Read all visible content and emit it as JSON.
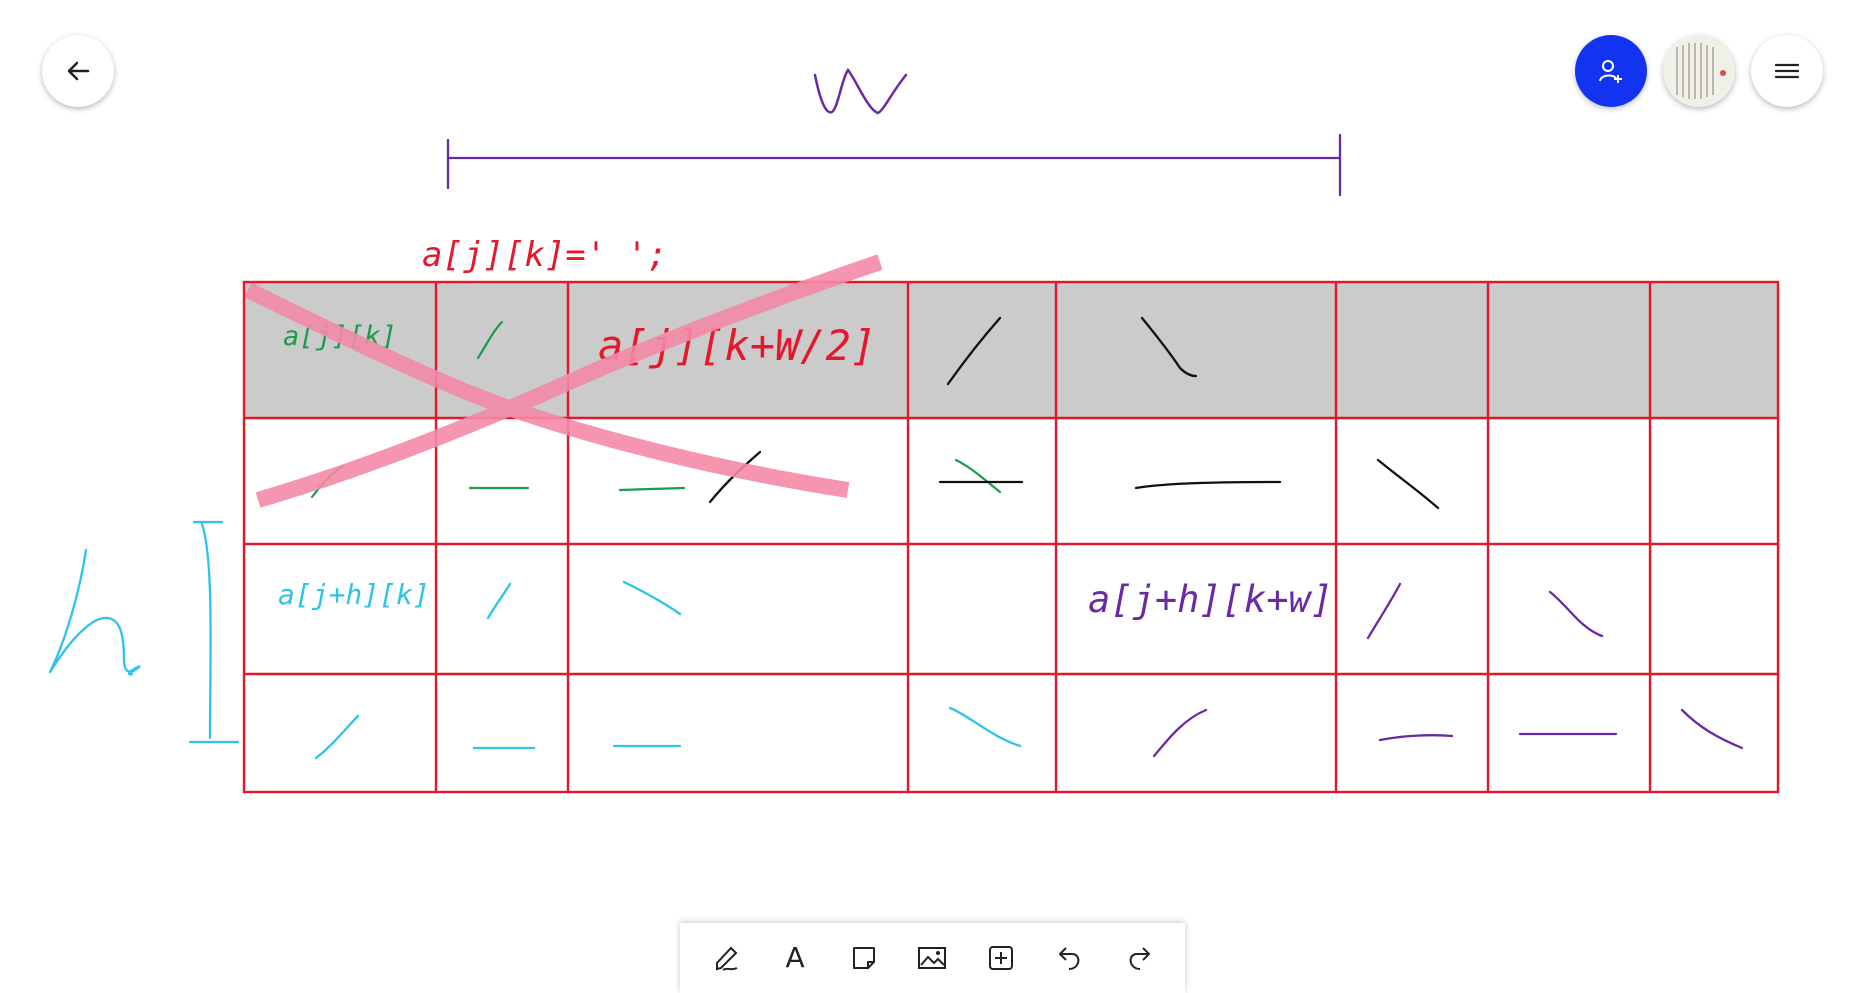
{
  "header": {
    "back": {
      "icon": "arrow-left-icon"
    },
    "invite": {
      "icon": "person-add-icon",
      "color": "#1234f0"
    },
    "avatar": {
      "icon": "avatar-image"
    },
    "menu": {
      "icon": "hamburger-menu-icon"
    }
  },
  "board": {
    "width_label": "W",
    "height_label": "h",
    "red_note": "a[j][k]=' ';",
    "cell_text": {
      "r0c0": "a[j][k]",
      "r0c2": "a[j][k+W/2]",
      "r2c0": "a[j+h][k]",
      "r2c4": "a[j+h][k+w]"
    },
    "colors": {
      "grid": "#e5182b",
      "header_fill": "#cbcbcb",
      "highlight_x": "#f48aa8",
      "green": "#1a9d4a",
      "red": "#e5182b",
      "cyan": "#2ec4ea",
      "purple": "#6a2aa6",
      "black": "#111111"
    }
  },
  "toolbar": {
    "tools": [
      {
        "name": "pen-tool",
        "icon": "pen-icon"
      },
      {
        "name": "text-tool",
        "icon": "text-icon",
        "label": "A"
      },
      {
        "name": "note-tool",
        "icon": "sticky-note-icon"
      },
      {
        "name": "image-tool",
        "icon": "image-icon"
      },
      {
        "name": "insert-tool",
        "icon": "plus-box-icon"
      },
      {
        "name": "undo-tool",
        "icon": "undo-icon"
      },
      {
        "name": "redo-tool",
        "icon": "redo-icon"
      }
    ]
  }
}
